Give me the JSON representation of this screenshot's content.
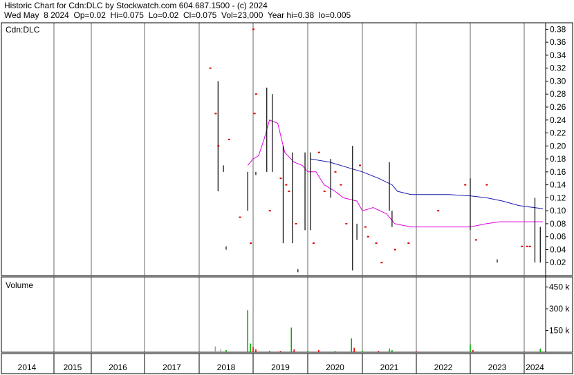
{
  "header": {
    "line1": "Historic Chart for Cdn:DLC by Stockwatch.com 604.687.1500 - (c) 2024",
    "line2": "Wed May  8 2024  Op=0.02  Hi=0.075  Lo=0.02  Cl=0.075  Vol=23,000  Year hi=0.38  lo=0.005"
  },
  "chart_data": {
    "type": "line",
    "symbol_label": "Cdn:DLC",
    "volume_label": "Volume",
    "years": [
      "2014",
      "2015",
      "2016",
      "2017",
      "2018",
      "2019",
      "2020",
      "2021",
      "2022",
      "2023",
      "2024"
    ],
    "price_axis": {
      "ylim": [
        0,
        0.39
      ],
      "ticks": [
        "0.38",
        "0.36",
        "0.34",
        "0.32",
        "0.30",
        "0.28",
        "0.26",
        "0.24",
        "0.22",
        "0.20",
        "0.18",
        "0.16",
        "0.14",
        "0.12",
        "0.10",
        "0.08",
        "0.06",
        "0.04",
        "0.02"
      ]
    },
    "volume_axis": {
      "ylim": [
        0,
        520
      ],
      "ticks": [
        "450 k",
        "300 k",
        "150 k"
      ]
    },
    "colors": {
      "axis": "#000000",
      "bar": "#000000",
      "ma_short": "#e000e0",
      "ma_long": "#1a1ab0",
      "red": "#e00000",
      "green": "#00b000",
      "gray_volume": "#a0a0a0"
    },
    "price_bars": [
      {
        "t": 2018.35,
        "hi": 0.3,
        "lo": 0.13
      },
      {
        "t": 2018.45,
        "hi": 0.17,
        "lo": 0.16
      },
      {
        "t": 2018.5,
        "hi": 0.045,
        "lo": 0.04
      },
      {
        "t": 2018.9,
        "hi": 0.16,
        "lo": 0.1
      },
      {
        "t": 2019.05,
        "hi": 0.16,
        "lo": 0.155
      },
      {
        "t": 2019.25,
        "hi": 0.29,
        "lo": 0.16
      },
      {
        "t": 2019.35,
        "hi": 0.28,
        "lo": 0.16
      },
      {
        "t": 2019.55,
        "hi": 0.2,
        "lo": 0.05
      },
      {
        "t": 2019.72,
        "hi": 0.19,
        "lo": 0.05
      },
      {
        "t": 2019.82,
        "hi": 0.01,
        "lo": 0.005
      },
      {
        "t": 2019.95,
        "hi": 0.19,
        "lo": 0.07
      },
      {
        "t": 2020.05,
        "hi": 0.19,
        "lo": 0.07
      },
      {
        "t": 2020.42,
        "hi": 0.18,
        "lo": 0.12
      },
      {
        "t": 2020.82,
        "hi": 0.2,
        "lo": 0.008
      },
      {
        "t": 2020.9,
        "hi": 0.08,
        "lo": 0.055
      },
      {
        "t": 2021.5,
        "hi": 0.175,
        "lo": 0.1
      },
      {
        "t": 2021.55,
        "hi": 0.1,
        "lo": 0.075
      },
      {
        "t": 2023.0,
        "hi": 0.15,
        "lo": 0.07
      },
      {
        "t": 2023.5,
        "hi": 0.025,
        "lo": 0.02
      },
      {
        "t": 2024.2,
        "hi": 0.12,
        "lo": 0.02
      },
      {
        "t": 2024.3,
        "hi": 0.075,
        "lo": 0.02
      }
    ],
    "price_dots": [
      {
        "t": 2018.2,
        "v": 0.32
      },
      {
        "t": 2018.3,
        "v": 0.25
      },
      {
        "t": 2018.35,
        "v": 0.2
      },
      {
        "t": 2018.55,
        "v": 0.21
      },
      {
        "t": 2018.75,
        "v": 0.09
      },
      {
        "t": 2018.95,
        "v": 0.05
      },
      {
        "t": 2019.0,
        "v": 0.38
      },
      {
        "t": 2019.02,
        "v": 0.25
      },
      {
        "t": 2019.05,
        "v": 0.28
      },
      {
        "t": 2019.3,
        "v": 0.1
      },
      {
        "t": 2019.5,
        "v": 0.15
      },
      {
        "t": 2019.6,
        "v": 0.14
      },
      {
        "t": 2019.65,
        "v": 0.13
      },
      {
        "t": 2019.78,
        "v": 0.08
      },
      {
        "t": 2020.1,
        "v": 0.05
      },
      {
        "t": 2020.2,
        "v": 0.19
      },
      {
        "t": 2020.3,
        "v": 0.13
      },
      {
        "t": 2020.5,
        "v": 0.16
      },
      {
        "t": 2020.6,
        "v": 0.14
      },
      {
        "t": 2020.7,
        "v": 0.08
      },
      {
        "t": 2020.95,
        "v": 0.17
      },
      {
        "t": 2021.05,
        "v": 0.075
      },
      {
        "t": 2021.1,
        "v": 0.06
      },
      {
        "t": 2021.25,
        "v": 0.05
      },
      {
        "t": 2021.35,
        "v": 0.02
      },
      {
        "t": 2021.6,
        "v": 0.04
      },
      {
        "t": 2021.85,
        "v": 0.05
      },
      {
        "t": 2022.4,
        "v": 0.1
      },
      {
        "t": 2022.9,
        "v": 0.14
      },
      {
        "t": 2023.1,
        "v": 0.055
      },
      {
        "t": 2023.3,
        "v": 0.14
      },
      {
        "t": 2023.95,
        "v": 0.045
      },
      {
        "t": 2024.05,
        "v": 0.045
      },
      {
        "t": 2024.1,
        "v": 0.045
      }
    ],
    "ma_short": [
      {
        "t": 2018.9,
        "v": 0.17
      },
      {
        "t": 2019.0,
        "v": 0.18
      },
      {
        "t": 2019.1,
        "v": 0.185
      },
      {
        "t": 2019.2,
        "v": 0.21
      },
      {
        "t": 2019.3,
        "v": 0.24
      },
      {
        "t": 2019.45,
        "v": 0.235
      },
      {
        "t": 2019.58,
        "v": 0.19
      },
      {
        "t": 2019.75,
        "v": 0.175
      },
      {
        "t": 2019.9,
        "v": 0.17
      },
      {
        "t": 2020.0,
        "v": 0.16
      },
      {
        "t": 2020.15,
        "v": 0.16
      },
      {
        "t": 2020.3,
        "v": 0.14
      },
      {
        "t": 2020.5,
        "v": 0.13
      },
      {
        "t": 2020.65,
        "v": 0.12
      },
      {
        "t": 2020.9,
        "v": 0.115
      },
      {
        "t": 2021.0,
        "v": 0.1
      },
      {
        "t": 2021.2,
        "v": 0.105
      },
      {
        "t": 2021.45,
        "v": 0.095
      },
      {
        "t": 2021.6,
        "v": 0.08
      },
      {
        "t": 2021.9,
        "v": 0.075
      },
      {
        "t": 2022.5,
        "v": 0.075
      },
      {
        "t": 2023.0,
        "v": 0.075
      },
      {
        "t": 2023.3,
        "v": 0.08
      },
      {
        "t": 2023.55,
        "v": 0.083
      },
      {
        "t": 2024.35,
        "v": 0.083
      }
    ],
    "ma_long": [
      {
        "t": 2020.05,
        "v": 0.18
      },
      {
        "t": 2020.4,
        "v": 0.175
      },
      {
        "t": 2020.8,
        "v": 0.165
      },
      {
        "t": 2021.0,
        "v": 0.16
      },
      {
        "t": 2021.3,
        "v": 0.15
      },
      {
        "t": 2021.55,
        "v": 0.14
      },
      {
        "t": 2021.65,
        "v": 0.13
      },
      {
        "t": 2021.9,
        "v": 0.125
      },
      {
        "t": 2022.6,
        "v": 0.125
      },
      {
        "t": 2023.0,
        "v": 0.123
      },
      {
        "t": 2023.3,
        "v": 0.12
      },
      {
        "t": 2023.6,
        "v": 0.115
      },
      {
        "t": 2023.9,
        "v": 0.108
      },
      {
        "t": 2024.35,
        "v": 0.103
      }
    ],
    "volume_bars": [
      {
        "t": 2018.3,
        "v": 40,
        "c": "gray_volume"
      },
      {
        "t": 2018.4,
        "v": 20,
        "c": "gray_volume"
      },
      {
        "t": 2018.5,
        "v": 15,
        "c": "green"
      },
      {
        "t": 2018.9,
        "v": 290,
        "c": "green"
      },
      {
        "t": 2018.95,
        "v": 60,
        "c": "green"
      },
      {
        "t": 2019.0,
        "v": 35,
        "c": "red"
      },
      {
        "t": 2019.05,
        "v": 20,
        "c": "red"
      },
      {
        "t": 2019.3,
        "v": 10,
        "c": "green"
      },
      {
        "t": 2019.5,
        "v": 8,
        "c": "red"
      },
      {
        "t": 2019.7,
        "v": 170,
        "c": "green"
      },
      {
        "t": 2019.75,
        "v": 20,
        "c": "red"
      },
      {
        "t": 2020.0,
        "v": 10,
        "c": "green"
      },
      {
        "t": 2020.2,
        "v": 15,
        "c": "red"
      },
      {
        "t": 2020.5,
        "v": 8,
        "c": "green"
      },
      {
        "t": 2020.8,
        "v": 95,
        "c": "green"
      },
      {
        "t": 2020.85,
        "v": 30,
        "c": "red"
      },
      {
        "t": 2021.0,
        "v": 10,
        "c": "green"
      },
      {
        "t": 2021.3,
        "v": 8,
        "c": "red"
      },
      {
        "t": 2021.5,
        "v": 25,
        "c": "green"
      },
      {
        "t": 2021.55,
        "v": 15,
        "c": "green"
      },
      {
        "t": 2022.0,
        "v": 6,
        "c": "red"
      },
      {
        "t": 2023.0,
        "v": 55,
        "c": "green"
      },
      {
        "t": 2023.05,
        "v": 15,
        "c": "red"
      },
      {
        "t": 2024.3,
        "v": 25,
        "c": "green"
      }
    ]
  }
}
